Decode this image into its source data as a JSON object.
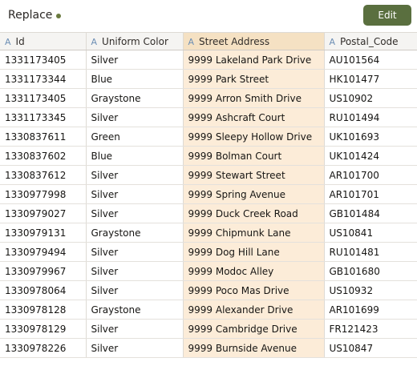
{
  "header": {
    "title": "Replace",
    "status_color": "#6a7a3f",
    "edit_label": "Edit",
    "edit_color": "#5a6f3f"
  },
  "table": {
    "columns": [
      {
        "type_icon": "A",
        "label": "Id"
      },
      {
        "type_icon": "A",
        "label": "Uniform Color"
      },
      {
        "type_icon": "A",
        "label": "Street Address"
      },
      {
        "type_icon": "A",
        "label": "Postal_Code"
      }
    ],
    "rows": [
      [
        "1331173405",
        "Silver",
        "9999 Lakeland Park Drive",
        "AU101564"
      ],
      [
        "1331173344",
        "Blue",
        "9999 Park Street",
        "HK101477"
      ],
      [
        "1331173405",
        "Graystone",
        "9999 Arron Smith Drive",
        "US10902"
      ],
      [
        "1331173345",
        "Silver",
        "9999 Ashcraft Court",
        "RU101494"
      ],
      [
        "1330837611",
        "Green",
        "9999 Sleepy Hollow Drive",
        "UK101693"
      ],
      [
        "1330837602",
        "Blue",
        "9999 Bolman Court",
        "UK101424"
      ],
      [
        "1330837612",
        "Silver",
        "9999 Stewart Street",
        "AR101700"
      ],
      [
        "1330977998",
        "Silver",
        "9999 Spring Avenue",
        "AR101701"
      ],
      [
        "1330979027",
        "Silver",
        "9999 Duck Creek Road",
        "GB101484"
      ],
      [
        "1330979131",
        "Graystone",
        "9999 Chipmunk Lane",
        "US10841"
      ],
      [
        "1330979494",
        "Silver",
        "9999 Dog Hill Lane",
        "RU101481"
      ],
      [
        "1330979967",
        "Silver",
        "9999 Modoc Alley",
        "GB101680"
      ],
      [
        "1330978064",
        "Silver",
        "9999 Poco Mas Drive",
        "US10932"
      ],
      [
        "1330978128",
        "Graystone",
        "9999 Alexander Drive",
        "AR101699"
      ],
      [
        "1330978129",
        "Silver",
        "9999 Cambridge Drive",
        "FR121423"
      ],
      [
        "1330978226",
        "Silver",
        "9999 Burnside Avenue",
        "US10847"
      ]
    ]
  }
}
